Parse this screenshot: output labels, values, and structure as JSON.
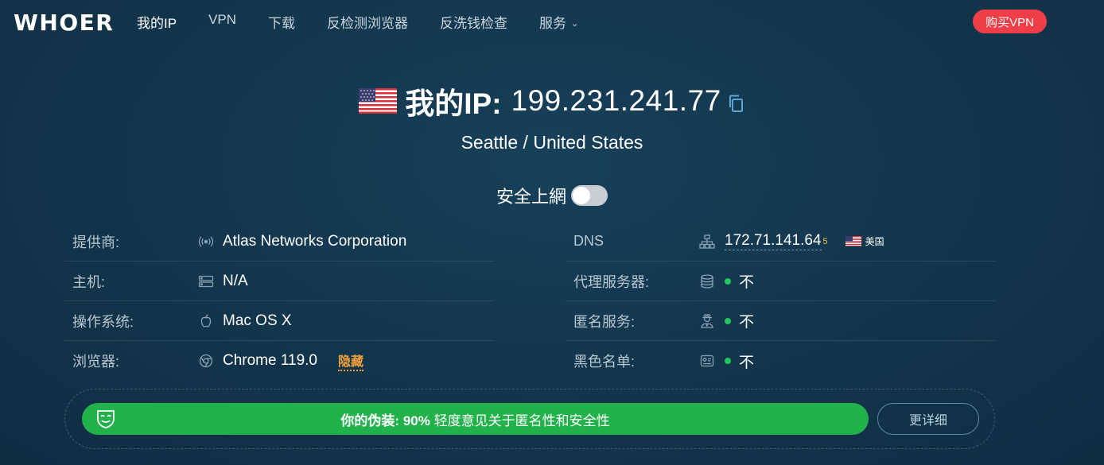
{
  "header": {
    "logo": "WHOER",
    "nav": [
      {
        "label": "我的IP",
        "active": true
      },
      {
        "label": "VPN"
      },
      {
        "label": "下载"
      },
      {
        "label": "反检测浏览器"
      },
      {
        "label": "反洗钱检查"
      },
      {
        "label": "服务",
        "has_dropdown": true
      }
    ],
    "buy_button": "购买VPN",
    "accent_color": "#ef3e47"
  },
  "hero": {
    "flag_icon": "us-flag-icon",
    "ip_label": "我的IP:",
    "ip_value": "199.231.241.77",
    "location": "Seattle / United States",
    "secure_label": "安全上網",
    "secure_enabled": false
  },
  "info_left": [
    {
      "label": "提供商:",
      "icon": "signal-icon",
      "value": "Atlas Networks Corporation"
    },
    {
      "label": "主机:",
      "icon": "server-icon",
      "value": "N/A"
    },
    {
      "label": "操作系统:",
      "icon": "apple-icon",
      "value": "Mac OS X"
    },
    {
      "label": "浏览器:",
      "icon": "chrome-icon",
      "value": "Chrome 119.0",
      "action": "隐藏"
    }
  ],
  "info_right": [
    {
      "label": "DNS",
      "icon": "network-icon",
      "value": "172.71.141.64",
      "superscript": "5",
      "country": "美国"
    },
    {
      "label": "代理服务器:",
      "icon": "database-icon",
      "value": "不"
    },
    {
      "label": "匿名服务:",
      "icon": "anonymous-icon",
      "value": "不"
    },
    {
      "label": "黑色名单:",
      "icon": "blacklist-icon",
      "value": "不"
    }
  ],
  "score": {
    "prefix": "你的伪装:",
    "percent": "90%",
    "suffix": "轻度意见关于匿名性和安全性",
    "more_button": "更详细",
    "bar_color": "#22b24c"
  }
}
